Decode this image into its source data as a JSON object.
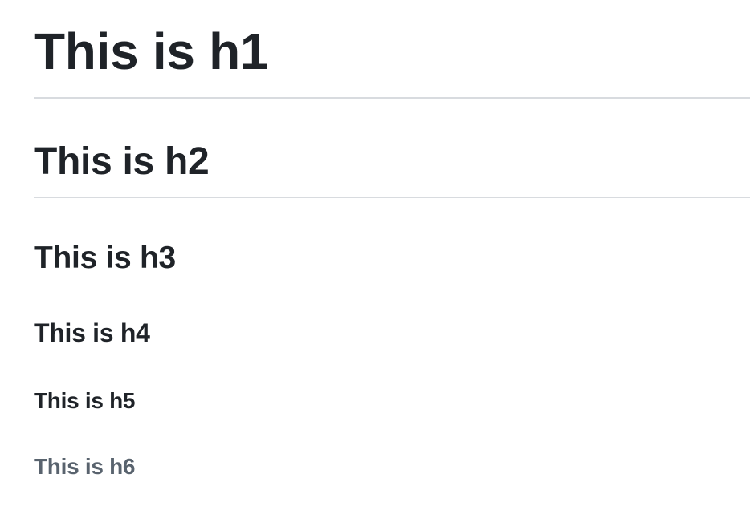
{
  "document": {
    "headings": {
      "h1": "This is h1",
      "h2": "This is h2",
      "h3": "This is h3",
      "h4": "This is h4",
      "h5": "This is h5",
      "h6": "This is h6"
    }
  },
  "colors": {
    "text": "#1f2328",
    "muted": "#59636e",
    "rule": "#d8dbdf",
    "background": "#ffffff"
  }
}
